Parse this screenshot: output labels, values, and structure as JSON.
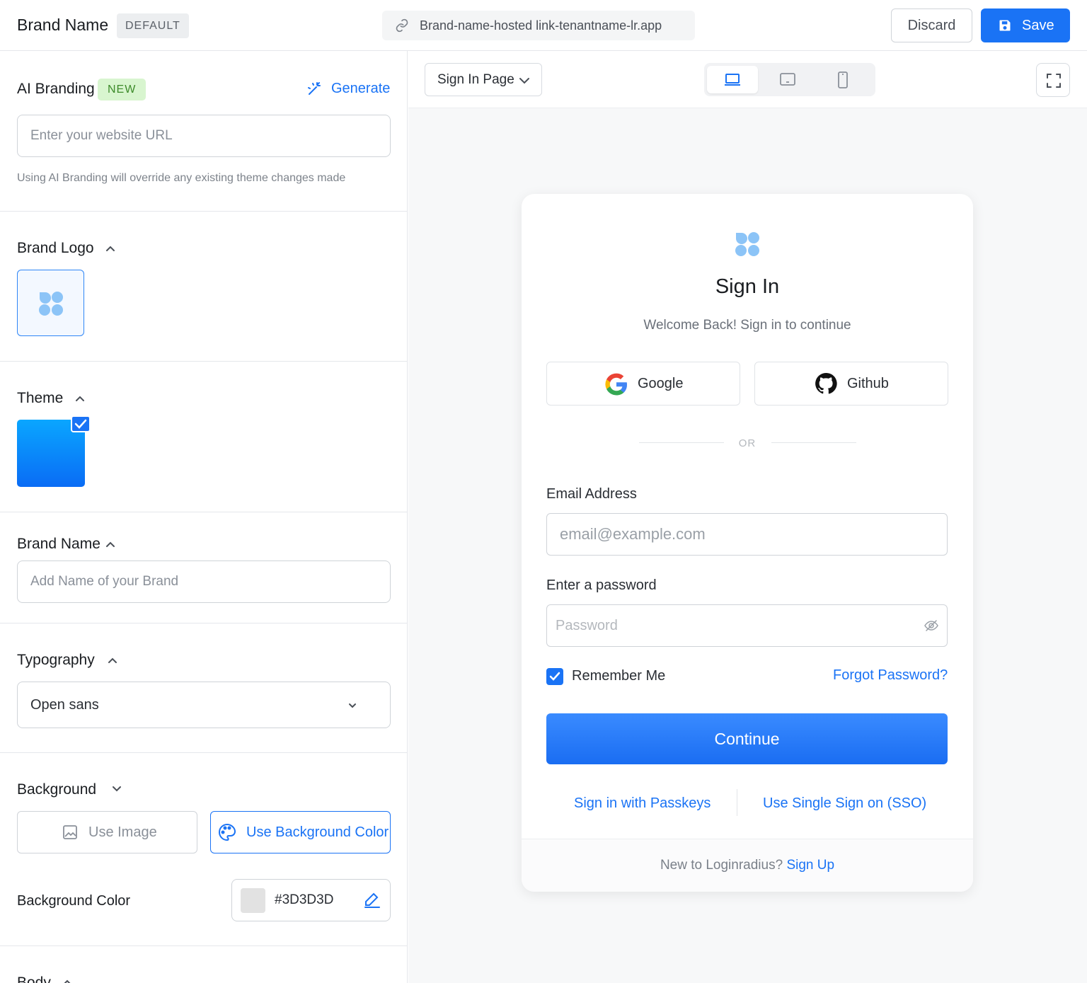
{
  "header": {
    "brand_name": "Brand Name",
    "badge": "DEFAULT",
    "hosted_link": "Brand-name-hosted link-tenantname-lr.app",
    "discard_label": "Discard",
    "save_label": "Save"
  },
  "left_panel": {
    "ai_branding": {
      "title": "AI Branding",
      "badge": "NEW",
      "generate_label": "Generate",
      "url_placeholder": "Enter your website URL",
      "helper": "Using AI Branding will override any existing theme changes made"
    },
    "brand_logo": {
      "title": "Brand Logo"
    },
    "theme": {
      "title": "Theme",
      "selected_color": "#0a8cff"
    },
    "brand_name": {
      "title": "Brand Name",
      "placeholder": "Add Name of your Brand"
    },
    "typography": {
      "title": "Typography",
      "selected_font": "Open sans"
    },
    "background": {
      "title": "Background",
      "use_image_label": "Use Image",
      "use_color_label": "Use Background Color",
      "color_label": "Background Color",
      "color_value": "#3D3D3D"
    },
    "body": {
      "title": "Body"
    }
  },
  "preview": {
    "page_select": "Sign In Page",
    "devices": [
      "desktop-icon",
      "tablet-icon",
      "mobile-icon"
    ],
    "active_device": "desktop-icon",
    "card": {
      "title": "Sign In",
      "subtitle": "Welcome Back! Sign in to continue",
      "google_label": "Google",
      "github_label": "Github",
      "or_label": "OR",
      "email_label": "Email Address",
      "email_placeholder": "email@example.com",
      "password_label": "Enter a password",
      "password_placeholder": "Password",
      "remember_label": "Remember Me",
      "remember_checked": true,
      "forgot_label": "Forgot Password?",
      "continue_label": "Continue",
      "passkeys_label": "Sign in with Passkeys",
      "sso_label": "Use Single Sign on (SSO)",
      "footer_text": "New to Loginradius?",
      "signup_label": "Sign Up"
    }
  },
  "colors": {
    "accent": "#1a73f5",
    "logo": "#8cc4f7"
  }
}
